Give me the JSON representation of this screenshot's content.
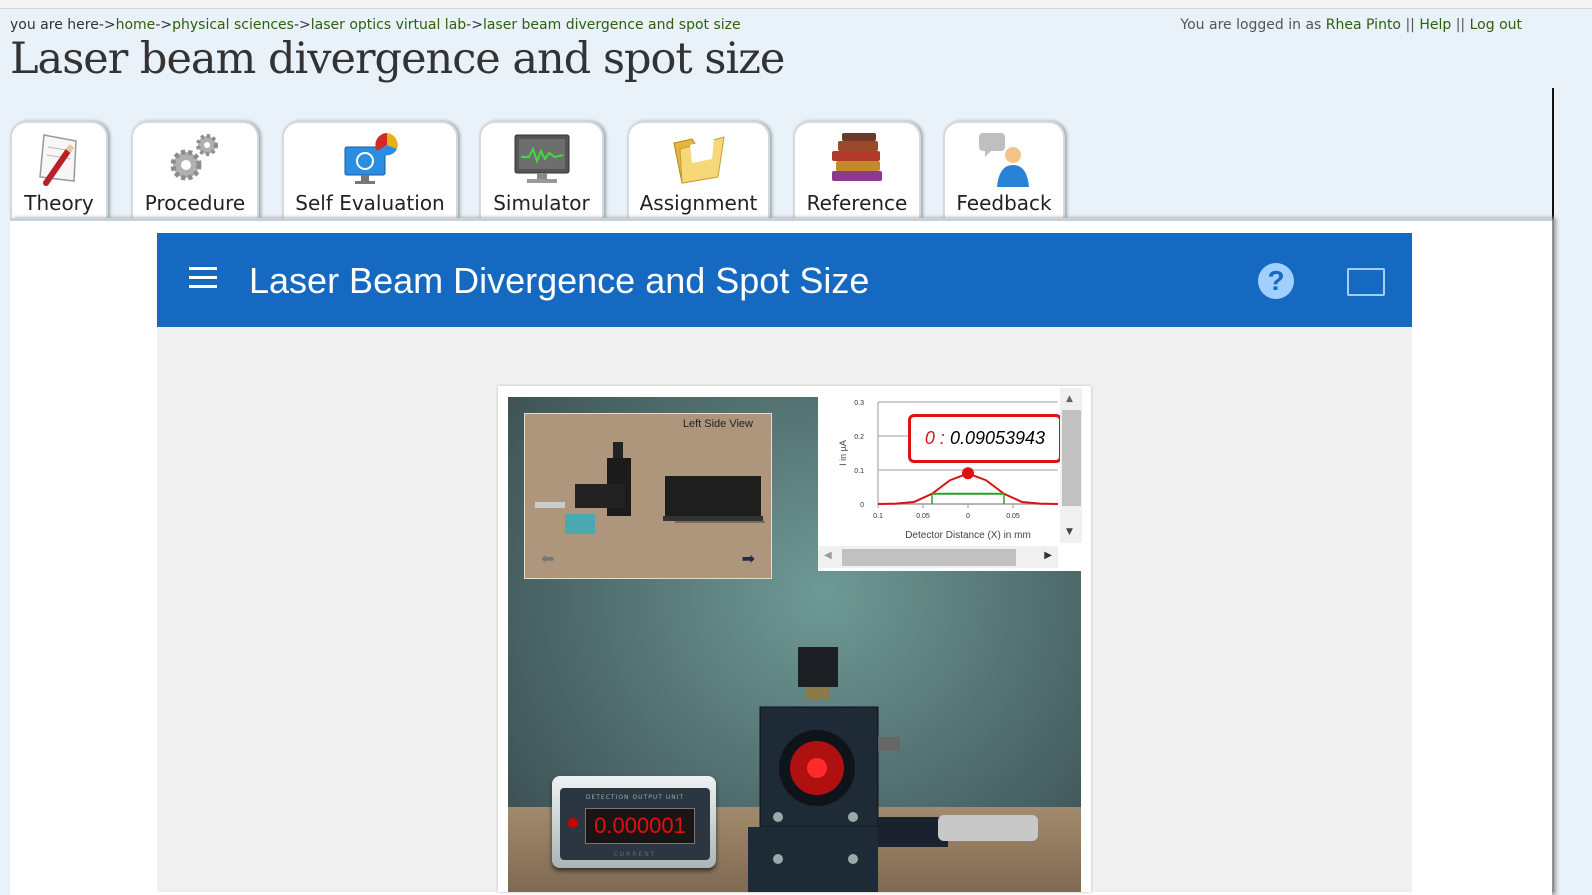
{
  "breadcrumb": {
    "prefix": "you are here->",
    "home": "home",
    "sep1": "->",
    "section": "physical sciences",
    "sep2": "->",
    "lab": "laser optics virtual lab",
    "sep3": "->",
    "page": "laser beam divergence and spot size"
  },
  "login": {
    "prefix": "You are logged in as",
    "user": "Rhea Pinto",
    "sep1": "||",
    "help": "Help",
    "sep2": "||",
    "logout": "Log out"
  },
  "page_title": "Laser beam divergence and spot size",
  "tabs": [
    {
      "label": "Theory",
      "icon": "pencil-paper-icon"
    },
    {
      "label": "Procedure",
      "icon": "gears-icon"
    },
    {
      "label": "Self Evaluation",
      "icon": "monitor-pie-icon"
    },
    {
      "label": "Simulator",
      "icon": "monitor-graph-icon"
    },
    {
      "label": "Assignment",
      "icon": "folder-icon"
    },
    {
      "label": "Reference",
      "icon": "books-icon"
    },
    {
      "label": "Feedback",
      "icon": "person-speech-icon"
    }
  ],
  "active_tab": "Simulator",
  "app": {
    "title": "Laser Beam Divergence and Spot Size",
    "help_icon": "help-icon",
    "fullscreen_icon": "fullscreen-icon"
  },
  "simulator": {
    "inset_caption": "Left Side View",
    "tooltip_key": "0 :",
    "tooltip_value": "0.09053943",
    "detector_label": "DETECTION OUTPUT UNIT",
    "detector_reading": "0.000001",
    "detector_sublabel": "CURRENT"
  },
  "chart_data": {
    "type": "line",
    "title": "",
    "xlabel": "Detector Distance (X) in mm",
    "ylabel": "I in µA",
    "x_ticks": [
      "0.1",
      "0.05",
      "0",
      "0.05"
    ],
    "y_ticks": [
      "0",
      "0.1",
      "0.2",
      "0.3"
    ],
    "ylim": [
      0,
      0.3
    ],
    "series": [
      {
        "x": [
          -0.1,
          -0.08,
          -0.06,
          -0.04,
          -0.02,
          0,
          0.02,
          0.04,
          0.06,
          0.08,
          0.1
        ],
        "y": [
          0,
          0.001,
          0.006,
          0.03,
          0.07,
          0.09,
          0.07,
          0.03,
          0.006,
          0.001,
          0
        ]
      }
    ],
    "highlight_point": {
      "x": 0,
      "y": 0.0905
    },
    "colors": {
      "curve": "#e01010",
      "marker": "#e01010",
      "width_bar": "#2aa02a"
    }
  }
}
